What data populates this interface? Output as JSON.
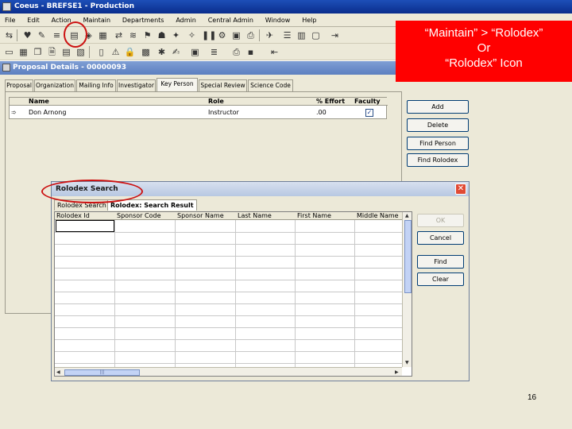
{
  "app": {
    "title": "Coeus - BREFSE1 - Production",
    "menu": [
      "File",
      "Edit",
      "Action",
      "Maintain",
      "Departments",
      "Admin",
      "Central Admin",
      "Window",
      "Help"
    ]
  },
  "callout": {
    "line1": "“Maintain” > “Rolodex”",
    "line2": "Or",
    "line3": "“Rolodex” Icon"
  },
  "proposal": {
    "window_title": "Proposal Details - 00000093",
    "tabs": [
      "Proposal",
      "Organization",
      "Mailing Info",
      "Investigator",
      "Key Person",
      "Special Review",
      "Science Code"
    ],
    "active_tab": "Key Person",
    "key_person_table": {
      "headers": [
        "Name",
        "Role",
        "% Effort",
        "Faculty"
      ],
      "rows": [
        {
          "name": "Don Arnong",
          "role": "Instructor",
          "effort": ".00",
          "faculty": true
        }
      ]
    },
    "buttons": [
      "Add",
      "Delete",
      "Find Person",
      "Find Rolodex"
    ]
  },
  "rolodex_dialog": {
    "title": "Rolodex Search",
    "tabs": [
      "Rolodex Search",
      "Rolodex: Search Result"
    ],
    "columns": [
      "Rolodex Id",
      "Sponsor Code",
      "Sponsor Name",
      "Last Name",
      "First Name",
      "Middle Name"
    ],
    "buttons": {
      "ok": "OK",
      "cancel": "Cancel",
      "find": "Find",
      "clear": "Clear"
    },
    "close_glyph": "✕"
  },
  "page_number": "16",
  "colors": {
    "callout": "#ff0000",
    "highlight_circle": "#cc1111",
    "titlebar": "#0a2d8c"
  }
}
